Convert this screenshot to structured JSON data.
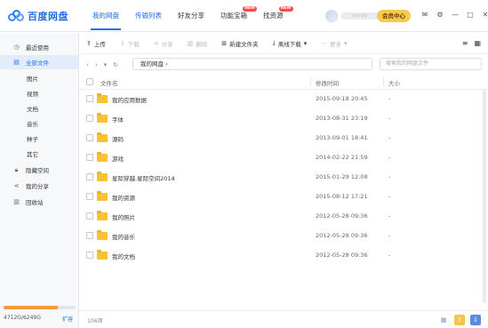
{
  "app": {
    "name": "百度网盘"
  },
  "nav": {
    "tabs": [
      {
        "label": "我的网盘",
        "active": true,
        "badge": ""
      },
      {
        "label": "传输列表",
        "active": false,
        "badge": ""
      },
      {
        "label": "好友分享",
        "active": false,
        "badge": ""
      },
      {
        "label": "功能宝箱",
        "active": false,
        "badge": "NEW"
      },
      {
        "label": "找资源",
        "active": false,
        "badge": "NEW"
      }
    ]
  },
  "user": {
    "name": "mindy",
    "vip_label": "会员中心"
  },
  "top_icons": [
    "mail-icon",
    "settings-icon",
    "minimize-icon",
    "maximize-icon",
    "close-icon"
  ],
  "sidebar": {
    "items": [
      {
        "label": "最近使用",
        "icon": "clock-icon",
        "sub": false,
        "active": false
      },
      {
        "label": "全部文件",
        "icon": "file-icon",
        "sub": false,
        "active": true
      },
      {
        "label": "图片",
        "icon": "",
        "sub": true,
        "active": false
      },
      {
        "label": "视频",
        "icon": "",
        "sub": true,
        "active": false
      },
      {
        "label": "文档",
        "icon": "",
        "sub": true,
        "active": false
      },
      {
        "label": "音乐",
        "icon": "",
        "sub": true,
        "active": false
      },
      {
        "label": "种子",
        "icon": "",
        "sub": true,
        "active": false
      },
      {
        "label": "其它",
        "icon": "",
        "sub": true,
        "active": false
      },
      {
        "label": "隐藏空间",
        "icon": "lock-icon",
        "sub": false,
        "active": false
      },
      {
        "label": "我的分享",
        "icon": "share-icon",
        "sub": false,
        "active": false
      },
      {
        "label": "回收站",
        "icon": "trash-icon",
        "sub": false,
        "active": false
      }
    ],
    "quota_text": "4712G/6249G",
    "quota_fraction": 0.754,
    "expand_label": "扩容"
  },
  "toolbar": {
    "upload": "上传",
    "download": "下载",
    "share": "分享",
    "delete": "删除",
    "new_folder": "新建文件夹",
    "offline_download": "离线下载",
    "more": "更多"
  },
  "address": {
    "path": "我的网盘",
    "search_placeholder": "搜索我的网盘文件"
  },
  "list": {
    "headers": {
      "name": "文件名",
      "modified": "修改时间",
      "size": "大小"
    },
    "rows": [
      {
        "name": "我的应用数据",
        "modified": "2015-09-18 20:45",
        "size": "-"
      },
      {
        "name": "字体",
        "modified": "2013-08-31 23:19",
        "size": "-"
      },
      {
        "name": "源码",
        "modified": "2013-09-01 18:41",
        "size": "-"
      },
      {
        "name": "游戏",
        "modified": "2014-02-22 21:59",
        "size": "-"
      },
      {
        "name": "星际穿越.星际空间2014",
        "modified": "2015-01-29 12:08",
        "size": "-"
      },
      {
        "name": "我的资源",
        "modified": "2015-08-12 17:21",
        "size": "-"
      },
      {
        "name": "我的照片",
        "modified": "2012-05-28 09:36",
        "size": "-"
      },
      {
        "name": "我的音乐",
        "modified": "2012-05-28 09:36",
        "size": "-"
      },
      {
        "name": "我的文档",
        "modified": "2012-05-28 09:36",
        "size": "-"
      }
    ]
  },
  "status": {
    "item_count": "106项"
  },
  "colors": {
    "accent": "#1f6fe5",
    "folder": "#f7c234",
    "vip": "#f6c94f",
    "quota": "#f29a3e"
  }
}
